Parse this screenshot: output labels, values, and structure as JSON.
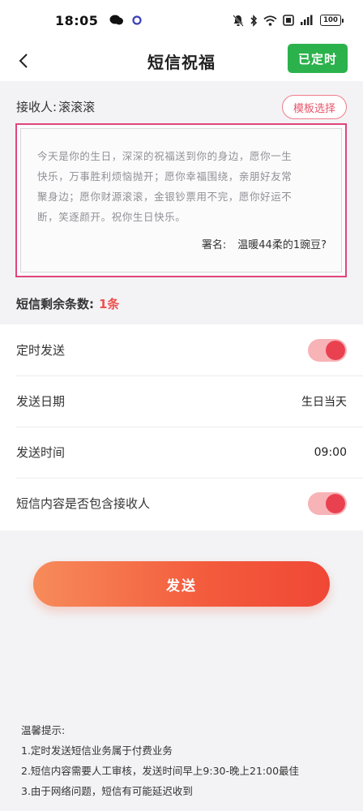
{
  "status_bar": {
    "time": "18:05",
    "battery": "100"
  },
  "nav": {
    "title": "短信祝福",
    "scheduled_label": "已定时"
  },
  "recipient": {
    "label": "接收人:",
    "name": "滚滚滚",
    "template_button": "模板选择"
  },
  "message": {
    "lines": [
      "今天是你的生日，深深的祝福送到你的身边，愿你一生",
      "快乐，万事胜利烦恼抛开；愿你幸福围绕，亲朋好友常",
      "聚身边；愿你财源滚滚，金银钞票用不完，愿你好运不",
      "断，笑逐颜开。祝你生日快乐。"
    ],
    "signature_label": "署名:",
    "signature_name": "温暖44柔的1豌豆?"
  },
  "sms_count": {
    "label": "短信剩余条数:",
    "value": "1条"
  },
  "settings": [
    {
      "label": "定时发送",
      "type": "toggle",
      "on": true
    },
    {
      "label": "发送日期",
      "type": "value",
      "value": "生日当天"
    },
    {
      "label": "发送时间",
      "type": "value",
      "value": "09:00"
    },
    {
      "label": "短信内容是否包含接收人",
      "type": "toggle",
      "on": true
    }
  ],
  "send_button": "发送",
  "tips": [
    "温馨提示:",
    "1.定时发送短信业务属于付费业务",
    "2.短信内容需要人工审核，发送时间早上9:30-晚上21:00最佳",
    "3.由于网络问题，短信有可能延迟收到"
  ],
  "colors": {
    "accent_green": "#2bb24c",
    "accent_red": "#ea4150",
    "highlight_border": "#e0457b"
  }
}
